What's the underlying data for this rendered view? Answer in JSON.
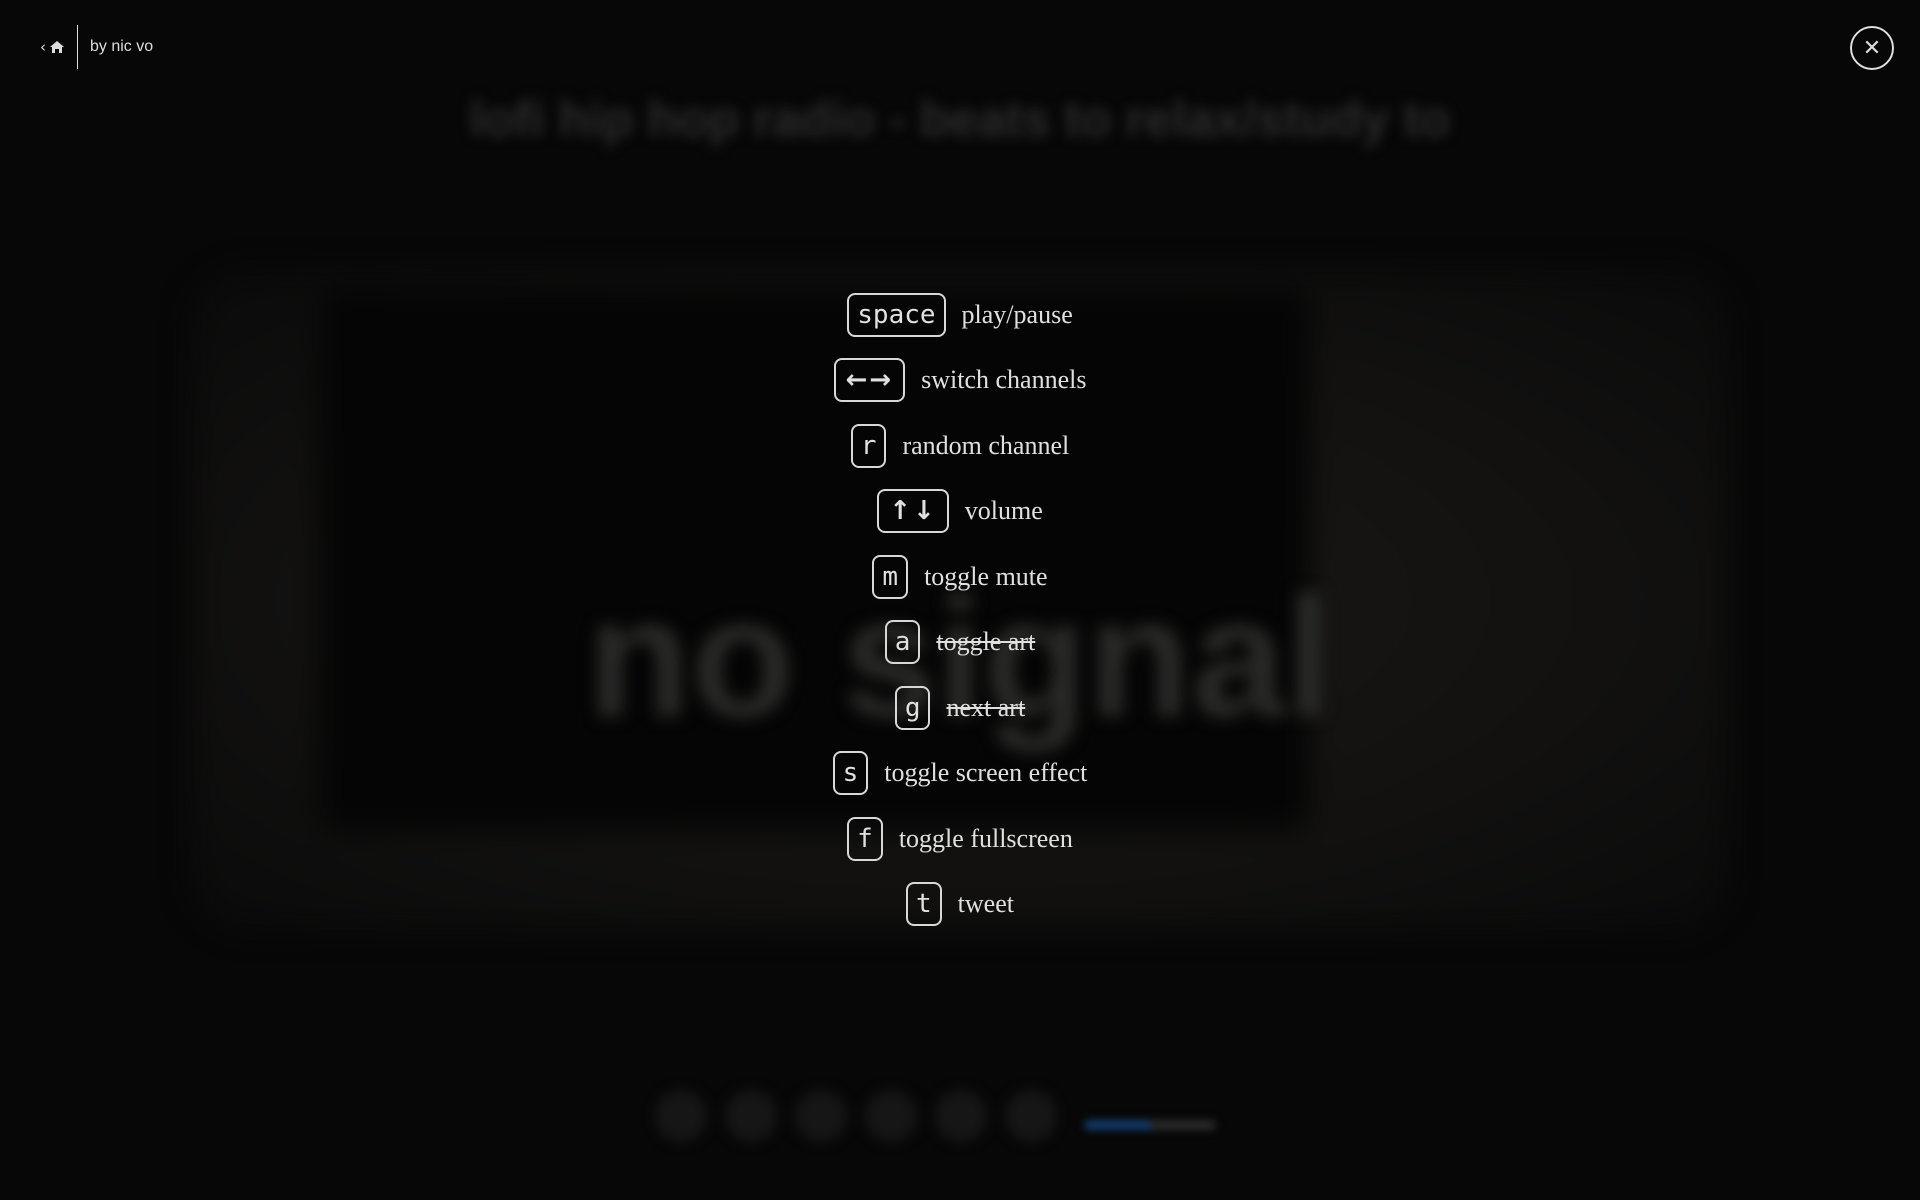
{
  "background": {
    "title": "lofi hip hop radio - beats to relax/study to",
    "screen_text": "no signal",
    "volume_fraction": 0.5,
    "accent": "#123a6a"
  },
  "header": {
    "back_icon": "chevron-left-icon",
    "home_icon": "home-icon",
    "byline": "by nic vo"
  },
  "close_icon": "close-circle-icon",
  "shortcuts": [
    {
      "key": "space",
      "label": "play/pause",
      "disabled": false
    },
    {
      "key": "←→",
      "label": "switch channels",
      "disabled": false
    },
    {
      "key": "r",
      "label": "random channel",
      "disabled": false
    },
    {
      "key": "↑↓",
      "label": "volume",
      "disabled": false
    },
    {
      "key": "m",
      "label": "toggle mute",
      "disabled": false
    },
    {
      "key": "a",
      "label": "toggle art",
      "disabled": true
    },
    {
      "key": "g",
      "label": "next art",
      "disabled": true
    },
    {
      "key": "s",
      "label": "toggle screen effect",
      "disabled": false
    },
    {
      "key": "f",
      "label": "toggle fullscreen",
      "disabled": false
    },
    {
      "key": "t",
      "label": "tweet",
      "disabled": false
    }
  ]
}
